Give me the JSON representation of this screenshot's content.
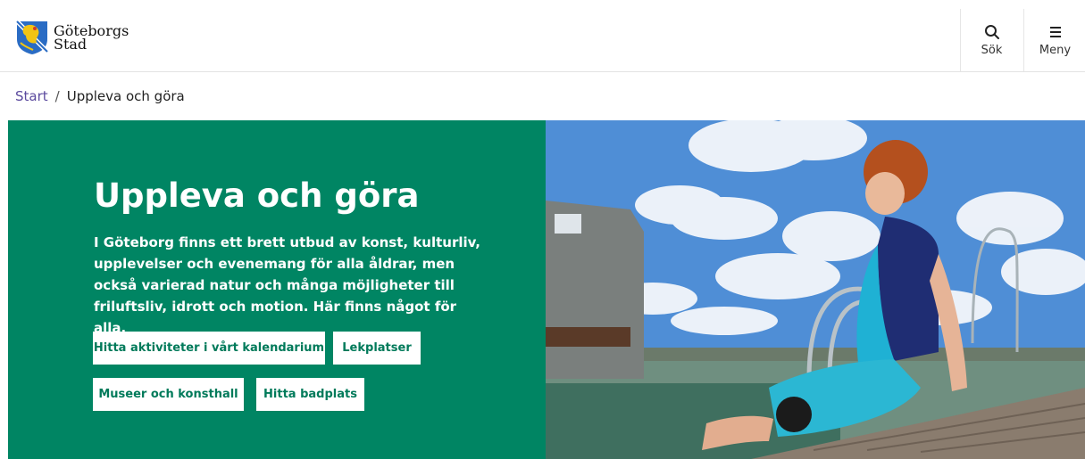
{
  "header": {
    "logo": {
      "line1": "Göteborgs",
      "line2": "Stad"
    },
    "search": {
      "label": "Sök",
      "icon": "search-icon"
    },
    "menu": {
      "label": "Meny",
      "icon": "hamburger-menu-icon"
    }
  },
  "breadcrumb": {
    "home": "Start",
    "separator": "/",
    "current": "Uppleva och göra"
  },
  "hero": {
    "title": "Uppleva och göra",
    "lead": "I Göteborg finns ett brett utbud av konst, kulturliv, upplevelser och evenemang för alla åldrar, men också varierad natur och många möjligheter till friluftsliv, idrott och motion. Här finns något för alla.",
    "buttons": [
      "Hitta aktiviteter i vårt kalendarium",
      "Lekplatser",
      "Museer och konsthall",
      "Hitta badplats"
    ],
    "panel_color": "#008563"
  },
  "colors": {
    "accent_green": "#008563",
    "link_purple": "#5b4a9e"
  }
}
